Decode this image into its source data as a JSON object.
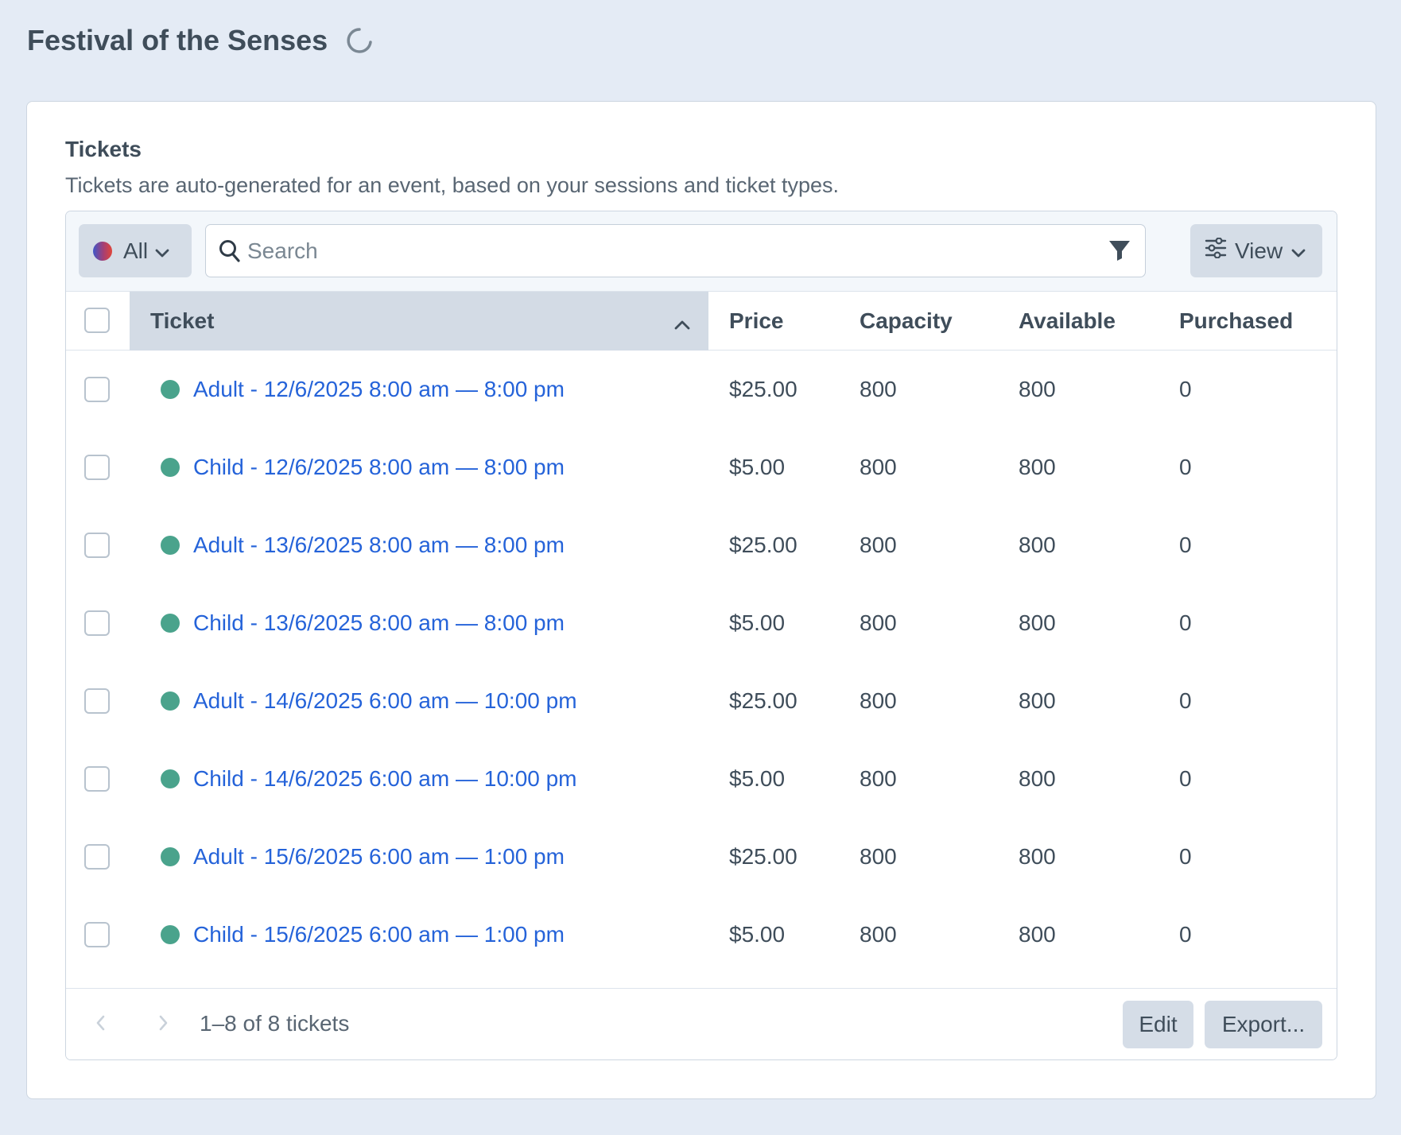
{
  "page": {
    "title": "Festival of the Senses"
  },
  "section": {
    "title": "Tickets",
    "description": "Tickets are auto-generated for an event, based on your sessions and ticket types."
  },
  "toolbar": {
    "status_filter": "All",
    "search_placeholder": "Search",
    "search_value": "",
    "view_label": "View",
    "icons": [
      "status-gradient-dot",
      "chevron-down-icon",
      "search-icon",
      "filter-icon",
      "sliders-icon"
    ]
  },
  "table": {
    "columns": {
      "ticket": "Ticket",
      "price": "Price",
      "capacity": "Capacity",
      "available": "Available",
      "purchased": "Purchased"
    },
    "sort_column": "Ticket",
    "rows": [
      {
        "ticket": "Adult - 12/6/2025 8:00 am — 8:00 pm",
        "price": "$25.00",
        "capacity": "800",
        "available": "800",
        "purchased": "0"
      },
      {
        "ticket": "Child - 12/6/2025 8:00 am — 8:00 pm",
        "price": "$5.00",
        "capacity": "800",
        "available": "800",
        "purchased": "0"
      },
      {
        "ticket": "Adult - 13/6/2025 8:00 am — 8:00 pm",
        "price": "$25.00",
        "capacity": "800",
        "available": "800",
        "purchased": "0"
      },
      {
        "ticket": "Child - 13/6/2025 8:00 am — 8:00 pm",
        "price": "$5.00",
        "capacity": "800",
        "available": "800",
        "purchased": "0"
      },
      {
        "ticket": "Adult - 14/6/2025 6:00 am — 10:00 pm",
        "price": "$25.00",
        "capacity": "800",
        "available": "800",
        "purchased": "0"
      },
      {
        "ticket": "Child - 14/6/2025 6:00 am — 10:00 pm",
        "price": "$5.00",
        "capacity": "800",
        "available": "800",
        "purchased": "0"
      },
      {
        "ticket": "Adult - 15/6/2025 6:00 am — 1:00 pm",
        "price": "$25.00",
        "capacity": "800",
        "available": "800",
        "purchased": "0"
      },
      {
        "ticket": "Child - 15/6/2025 6:00 am — 1:00 pm",
        "price": "$5.00",
        "capacity": "800",
        "available": "800",
        "purchased": "0"
      }
    ]
  },
  "footer": {
    "page_info": "1–8 of 8 tickets",
    "edit_label": "Edit",
    "export_label": "Export..."
  },
  "colors": {
    "background": "#e4ebf5",
    "link": "#2563d9",
    "enabled_status": "#4aa38c",
    "sorted_header": "#d3dbe5",
    "button": "#d5dde7"
  }
}
